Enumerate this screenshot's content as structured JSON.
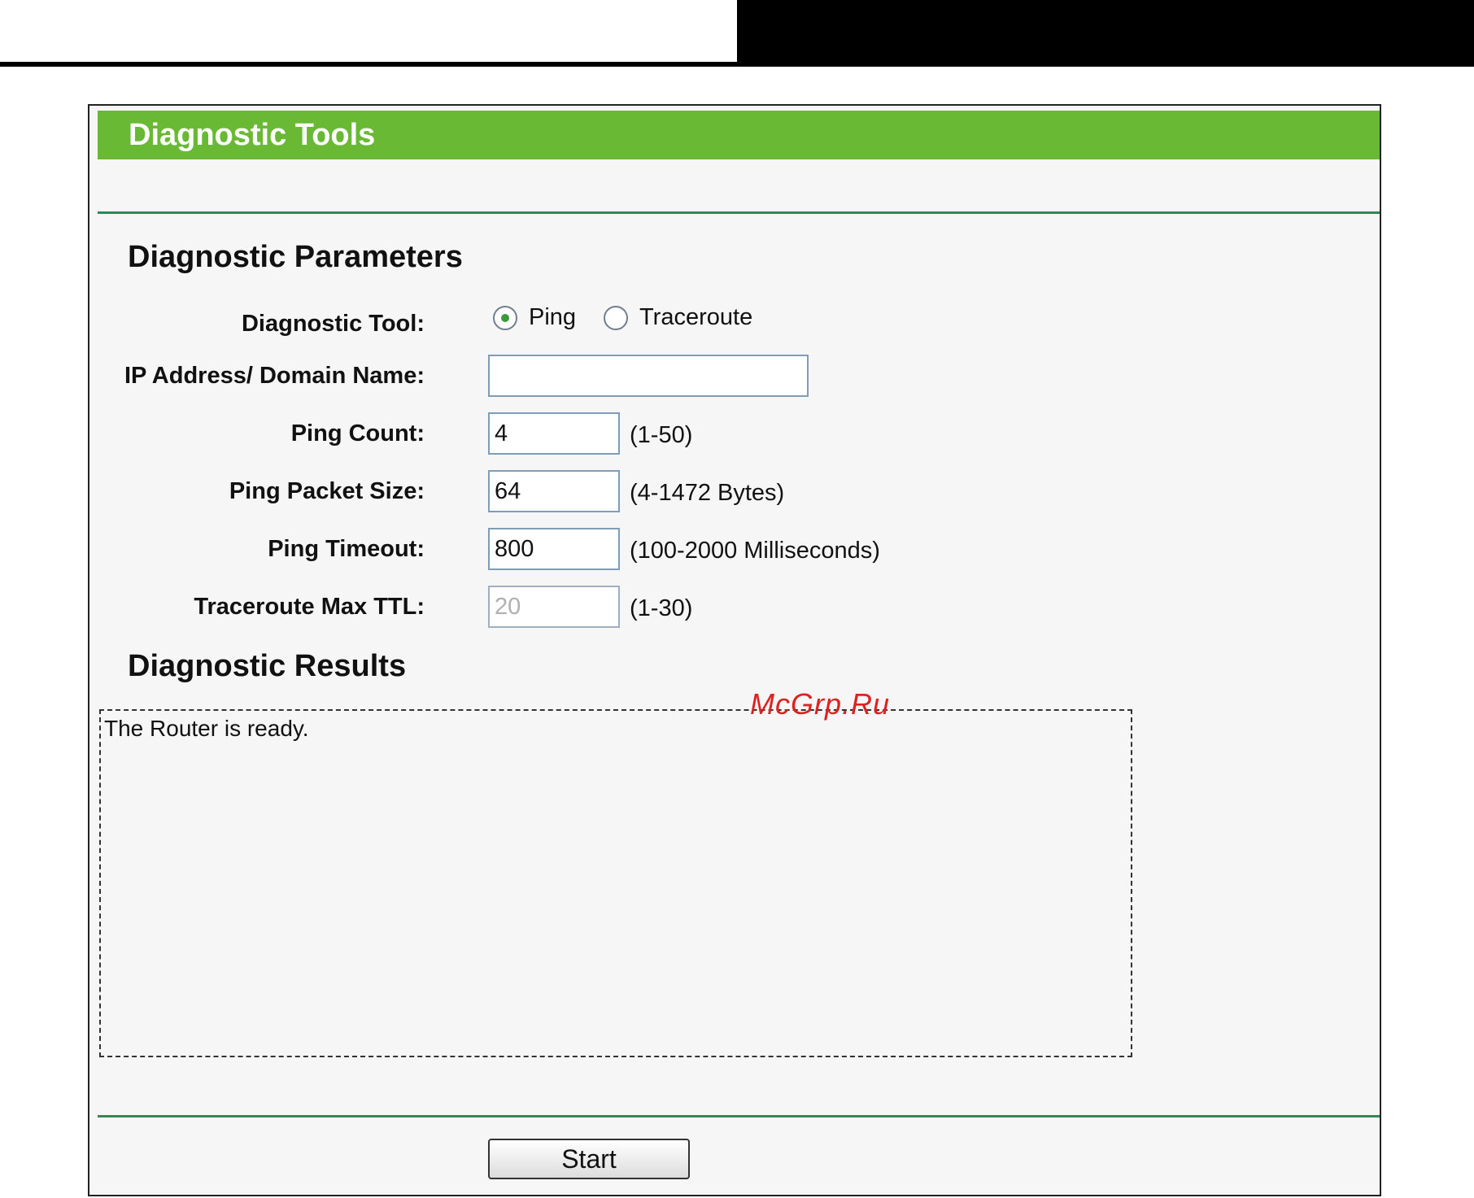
{
  "page": {
    "title": "Diagnostic Tools"
  },
  "parameters": {
    "heading": "Diagnostic Parameters",
    "diagnostic_tool": {
      "label": "Diagnostic Tool:",
      "options": [
        "Ping",
        "Traceroute"
      ],
      "selected": "Ping"
    },
    "ip_address": {
      "label": "IP Address/ Domain Name:",
      "value": ""
    },
    "ping_count": {
      "label": "Ping Count:",
      "value": "4",
      "hint": "(1-50)"
    },
    "ping_packet_size": {
      "label": "Ping Packet Size:",
      "value": "64",
      "hint": "(4-1472 Bytes)"
    },
    "ping_timeout": {
      "label": "Ping Timeout:",
      "value": "800",
      "hint": "(100-2000 Milliseconds)"
    },
    "traceroute_max_ttl": {
      "label": "Traceroute Max TTL:",
      "value": "20",
      "hint": "(1-30)"
    }
  },
  "results": {
    "heading": "Diagnostic Results",
    "text": "The Router is ready."
  },
  "actions": {
    "start_label": "Start"
  },
  "watermark": "McGrp.Ru",
  "colors": {
    "title_bar": "#6ab935",
    "separator": "#2d8a57"
  }
}
